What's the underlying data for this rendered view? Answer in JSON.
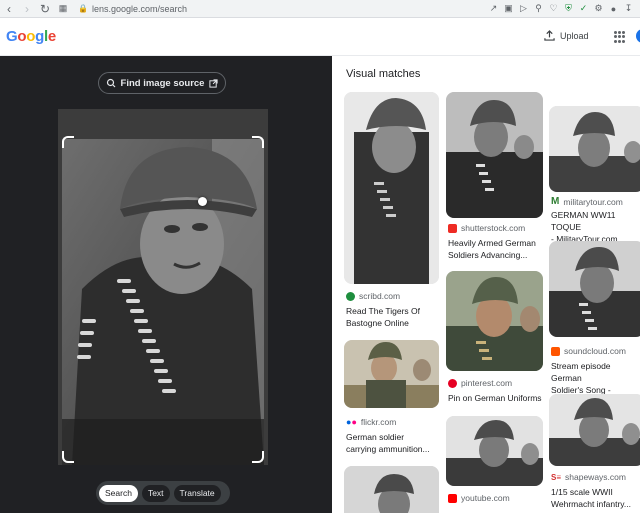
{
  "browser": {
    "url": "lens.google.com/search"
  },
  "header": {
    "logo": "Google",
    "upload_label": "Upload"
  },
  "left": {
    "find_image_source": "Find image source",
    "modes": [
      "Search",
      "Text",
      "Translate"
    ],
    "active_mode": "Search"
  },
  "right": {
    "title": "Visual matches",
    "results": [
      {
        "source": "scribd.com",
        "caption_1": "Read The Tigers Of",
        "caption_2": "Bastogne Online",
        "icon_color": "#1e8e3e"
      },
      {
        "source": "flickr.com",
        "caption_1": "German soldier",
        "caption_2": "carrying ammunition...",
        "icon_color": "#0063dc"
      },
      {
        "source": "shutterstock.com",
        "caption_1": "Heavily Armed German",
        "caption_2": "Soldiers Advancing...",
        "icon_color": "#ee2b24"
      },
      {
        "source": "pinterest.com",
        "caption_1": "Pin on German Uniforms",
        "caption_2": "",
        "icon_color": "#e60023"
      },
      {
        "source": "youtube.com",
        "caption_1": "",
        "caption_2": "",
        "icon_color": "#ff0000"
      },
      {
        "source": "militarytour.com",
        "caption_1": "GERMAN WW11 TOQUE",
        "caption_2": "- MilitaryTour.com",
        "icon_color": "#2e7d32"
      },
      {
        "source": "soundcloud.com",
        "caption_1": "Stream episode German",
        "caption_2": "Soldier's Song - \"Erika\"...",
        "icon_color": "#ff5500"
      },
      {
        "source": "shapeways.com",
        "caption_1": "1/15 scale WWII",
        "caption_2": "Wehrmacht infantry...",
        "icon_color": "#d32f2f"
      }
    ]
  }
}
